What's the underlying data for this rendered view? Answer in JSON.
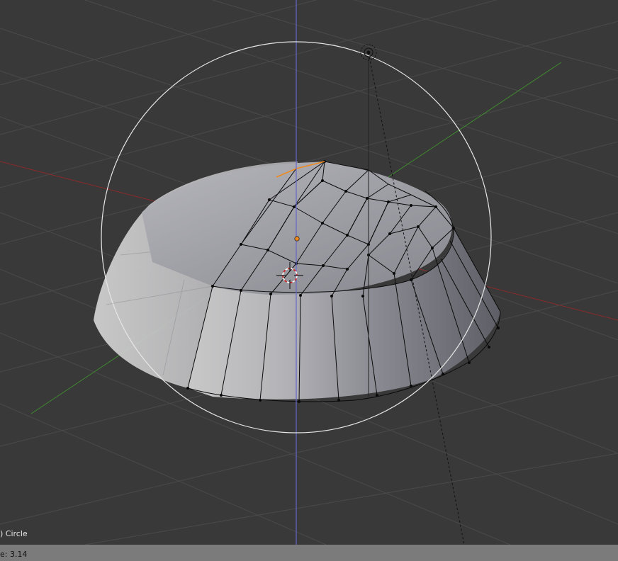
{
  "viewport": {
    "object_label": ") Circle",
    "background_color": "#393939",
    "grid_color": "#4a4a4a",
    "axis_x_color": "#8c2a2a",
    "axis_y_color": "#3f8a2e",
    "axis_z_color": "#6666cc",
    "selection_color": "#f08a1e",
    "mesh_face_color": "#9a9aa2",
    "edge_color": "#0a0a0a"
  },
  "statusbar": {
    "text": "e: 3.14",
    "background_color": "#7b7b7b"
  },
  "icons": {
    "lamp": "lamp-icon",
    "cursor": "3d-cursor-icon",
    "origin": "object-origin-dot"
  }
}
